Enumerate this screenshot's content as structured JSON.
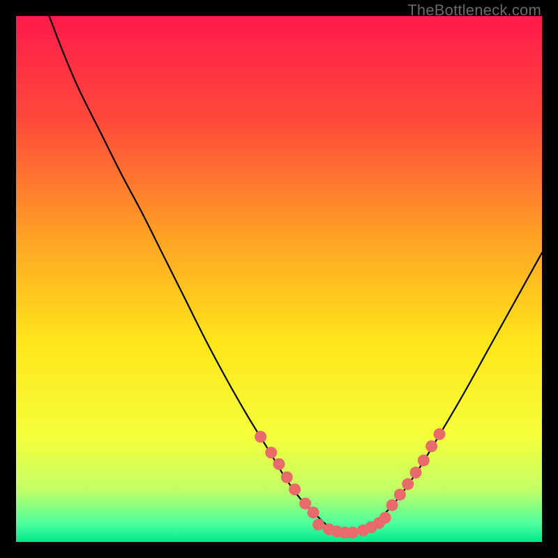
{
  "watermark": "TheBottleneck.com",
  "chart_data": {
    "type": "line",
    "title": "",
    "xlabel": "",
    "ylabel": "",
    "xlim": [
      0,
      100
    ],
    "ylim": [
      0,
      100
    ],
    "grid": false,
    "legend": false,
    "background_gradient": {
      "stops": [
        {
          "offset": 0.0,
          "color": "#ff1a4b"
        },
        {
          "offset": 0.2,
          "color": "#ff4a3a"
        },
        {
          "offset": 0.42,
          "color": "#ffa224"
        },
        {
          "offset": 0.62,
          "color": "#ffe61a"
        },
        {
          "offset": 0.8,
          "color": "#f4ff3a"
        },
        {
          "offset": 0.9,
          "color": "#c3ff66"
        },
        {
          "offset": 0.965,
          "color": "#4dff9e"
        },
        {
          "offset": 1.0,
          "color": "#00e98a"
        }
      ]
    },
    "series": [
      {
        "name": "curve",
        "type": "line",
        "stroke": "#000000",
        "stroke_width": 2.2,
        "x": [
          6.3,
          9,
          12,
          16,
          20,
          24,
          28,
          32,
          36,
          40,
          44,
          48,
          51,
          54,
          57,
          59,
          61,
          63,
          65,
          68,
          72,
          76,
          80,
          85,
          90,
          95,
          100
        ],
        "y": [
          100,
          93,
          86,
          78,
          70,
          62.5,
          54.5,
          46.5,
          38.5,
          31,
          24,
          17.5,
          12.5,
          8.3,
          5.2,
          3.3,
          2.2,
          1.7,
          2.0,
          3.5,
          7.5,
          13,
          19.5,
          28,
          37,
          46,
          55
        ]
      },
      {
        "name": "dots-left",
        "type": "scatter",
        "marker_color": "#e86a6a",
        "marker_radius": 8.5,
        "x": [
          46.5,
          48.5,
          50,
          51.5,
          53,
          55,
          56.5
        ],
        "y": [
          20,
          17,
          14.8,
          12.3,
          10,
          7.3,
          5.6
        ]
      },
      {
        "name": "dots-bottom",
        "type": "scatter",
        "marker_color": "#e86a6a",
        "marker_radius": 8.5,
        "x": [
          57.5,
          59.5,
          61,
          62.5,
          64,
          66,
          67.5,
          69,
          70.2
        ],
        "y": [
          3.3,
          2.4,
          2.0,
          1.8,
          1.8,
          2.2,
          2.8,
          3.6,
          4.6
        ]
      },
      {
        "name": "dots-right",
        "type": "scatter",
        "marker_color": "#e86a6a",
        "marker_radius": 8.5,
        "x": [
          71.5,
          73,
          74.5,
          76,
          77.5,
          79,
          80.5
        ],
        "y": [
          7.0,
          9.0,
          11.0,
          13.2,
          15.5,
          18.2,
          20.5
        ]
      }
    ]
  }
}
